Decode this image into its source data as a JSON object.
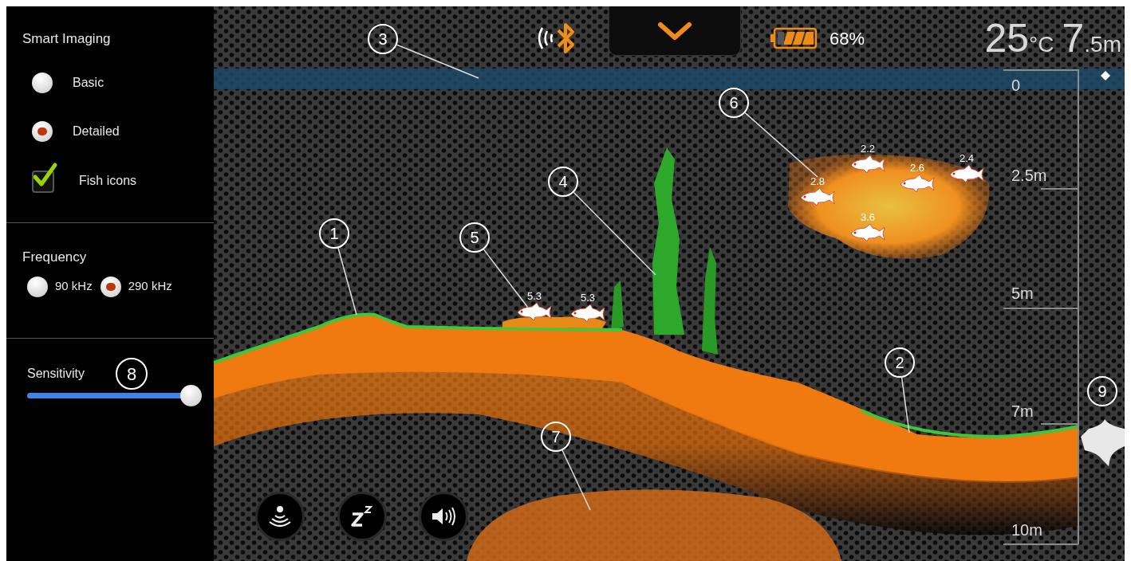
{
  "settings": {
    "smart_imaging": {
      "title": "Smart Imaging",
      "modes": [
        {
          "label": "Basic",
          "selected": false
        },
        {
          "label": "Detailed",
          "selected": true
        }
      ],
      "fish_icons": {
        "label": "Fish icons",
        "checked": true
      }
    },
    "frequency": {
      "title": "Frequency",
      "options": [
        {
          "label": "90 kHz",
          "selected": false
        },
        {
          "label": "290 kHz",
          "selected": true
        }
      ]
    },
    "sensitivity": {
      "label": "Sensitivity",
      "level": 0.98
    }
  },
  "menu": {
    "expanded": false
  },
  "status": {
    "battery": "68%",
    "temperature": "25",
    "temperature_unit": "°C",
    "depth_whole": "7",
    "depth_fraction": ".5m"
  },
  "depth_scale": [
    "0",
    "2.5m",
    "5m",
    "7m",
    "10m"
  ],
  "fish": [
    {
      "depth": "5.3"
    },
    {
      "depth": "5.3"
    },
    {
      "depth": "2.2"
    },
    {
      "depth": "2.6"
    },
    {
      "depth": "2.4"
    },
    {
      "depth": "2.8"
    },
    {
      "depth": "3.6"
    }
  ],
  "callouts": [
    "1",
    "2",
    "3",
    "4",
    "5",
    "6",
    "7",
    "8",
    "9"
  ]
}
